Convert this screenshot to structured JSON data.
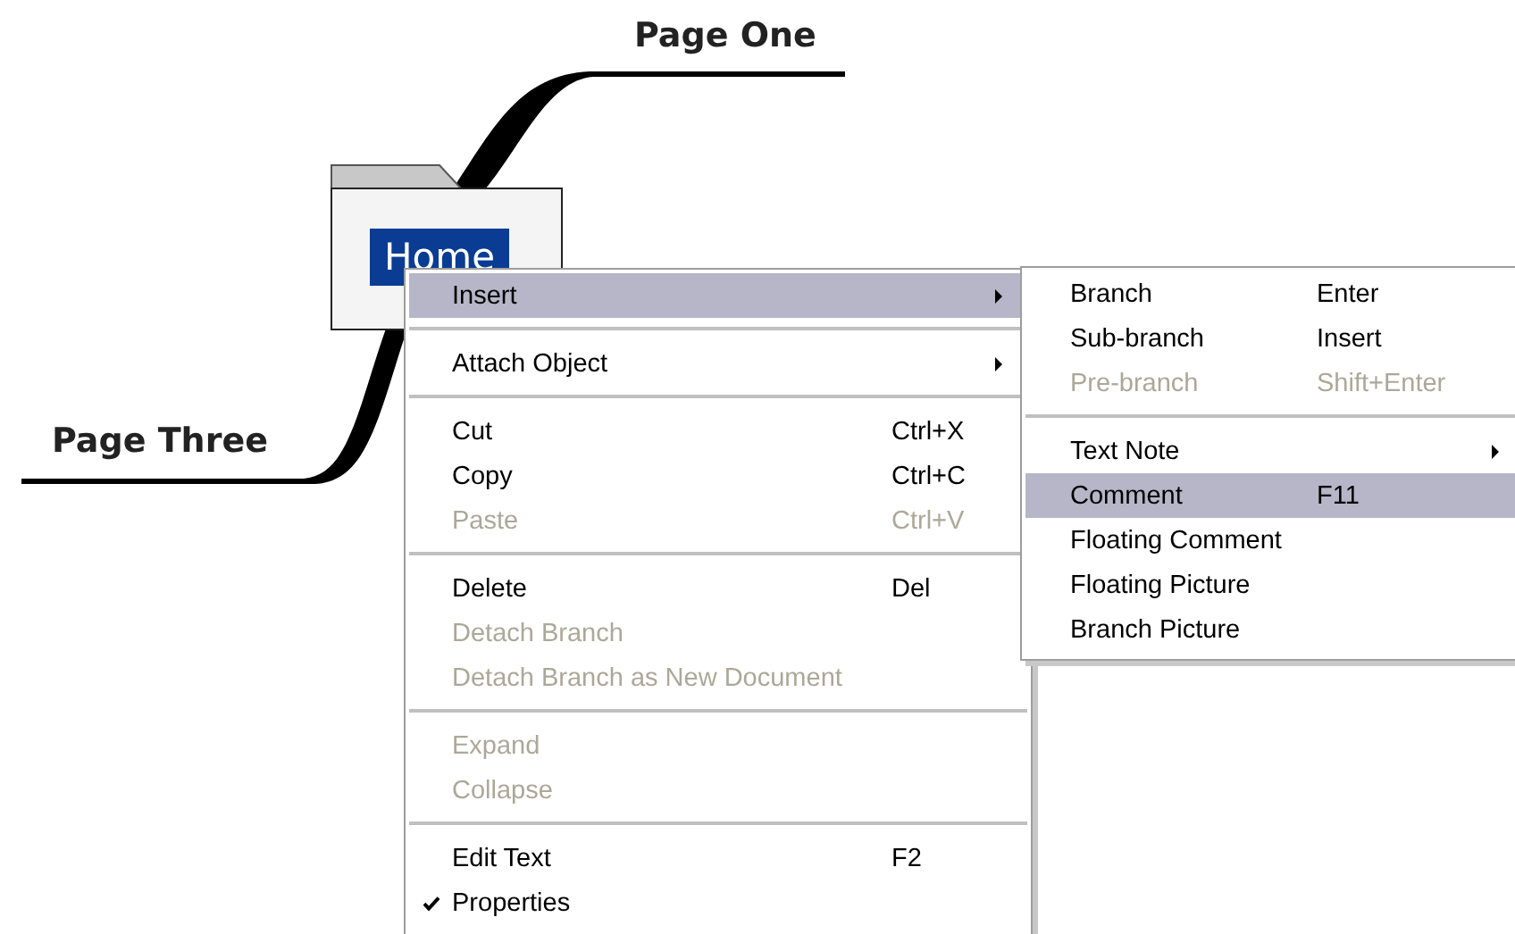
{
  "mind_map": {
    "central_topic": {
      "label": "Home",
      "selected": true
    },
    "branches": [
      {
        "label": "Page One"
      },
      {
        "label": "Page Three"
      }
    ]
  },
  "context_menu": {
    "sections": [
      {
        "items": [
          {
            "label": "Insert",
            "disabled": false,
            "selected": true,
            "checked": false,
            "has_submenu": true
          }
        ]
      },
      {
        "items": [
          {
            "label": "Attach Object",
            "disabled": false,
            "selected": false,
            "checked": false,
            "has_submenu": true
          }
        ]
      },
      {
        "items": [
          {
            "label": "Cut",
            "shortcut": "Ctrl+X",
            "disabled": false,
            "selected": false,
            "checked": false,
            "has_submenu": false
          },
          {
            "label": "Copy",
            "shortcut": "Ctrl+C",
            "disabled": false,
            "selected": false,
            "checked": false,
            "has_submenu": false
          },
          {
            "label": "Paste",
            "shortcut": "Ctrl+V",
            "disabled": true,
            "selected": false,
            "checked": false,
            "has_submenu": false
          }
        ]
      },
      {
        "items": [
          {
            "label": "Delete",
            "shortcut": "Del",
            "disabled": false,
            "selected": false,
            "checked": false,
            "has_submenu": false
          },
          {
            "label": "Detach Branch",
            "disabled": true,
            "selected": false,
            "checked": false,
            "has_submenu": false
          },
          {
            "label": "Detach Branch as New Document",
            "disabled": true,
            "selected": false,
            "checked": false,
            "has_submenu": false
          }
        ]
      },
      {
        "items": [
          {
            "label": "Expand",
            "disabled": true,
            "selected": false,
            "checked": false,
            "has_submenu": false
          },
          {
            "label": "Collapse",
            "disabled": true,
            "selected": false,
            "checked": false,
            "has_submenu": false
          }
        ]
      },
      {
        "items": [
          {
            "label": "Edit Text",
            "shortcut": "F2",
            "disabled": false,
            "selected": false,
            "checked": false,
            "has_submenu": false
          },
          {
            "label": "Properties",
            "disabled": false,
            "selected": false,
            "checked": true,
            "has_submenu": false
          }
        ]
      }
    ]
  },
  "submenu": {
    "sections": [
      {
        "items": [
          {
            "label": "Branch",
            "shortcut": "Enter",
            "disabled": false,
            "selected": false,
            "has_submenu": false
          },
          {
            "label": "Sub-branch",
            "shortcut": "Insert",
            "disabled": false,
            "selected": false,
            "has_submenu": false
          },
          {
            "label": "Pre-branch",
            "shortcut": "Shift+Enter",
            "disabled": true,
            "selected": false,
            "has_submenu": false
          }
        ]
      },
      {
        "items": [
          {
            "label": "Text Note",
            "disabled": false,
            "selected": false,
            "has_submenu": true
          },
          {
            "label": "Comment",
            "shortcut": "F11",
            "disabled": false,
            "selected": true,
            "has_submenu": false
          },
          {
            "label": "Floating Comment",
            "disabled": false,
            "selected": false,
            "has_submenu": false
          },
          {
            "label": "Floating Picture",
            "disabled": false,
            "selected": false,
            "has_submenu": false
          },
          {
            "label": "Branch Picture",
            "disabled": false,
            "selected": false,
            "has_submenu": false
          }
        ]
      }
    ]
  }
}
